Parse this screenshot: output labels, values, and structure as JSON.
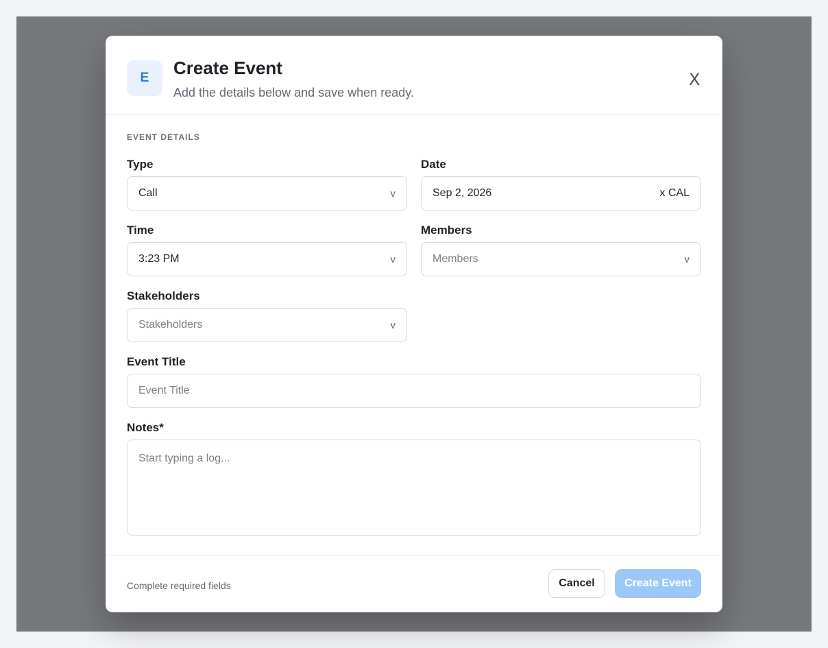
{
  "header": {
    "avatar_letter": "E",
    "title": "Create Event",
    "subtitle": "Add the details below and save when ready.",
    "close_label": "X"
  },
  "section": {
    "title": "EVENT DETAILS"
  },
  "fields": {
    "type": {
      "label": "Type",
      "value": "Call",
      "chevron": "v"
    },
    "date": {
      "label": "Date",
      "value": "Sep 2, 2026",
      "suffix": "x CAL"
    },
    "time": {
      "label": "Time",
      "value": "3:23 PM",
      "chevron": "v"
    },
    "members": {
      "label": "Members",
      "placeholder": "Members",
      "chevron": "v"
    },
    "stakeholders": {
      "label": "Stakeholders",
      "placeholder": "Stakeholders",
      "chevron": "v"
    },
    "event_title": {
      "label": "Event Title",
      "placeholder": "Event Title"
    },
    "notes": {
      "label": "Notes*",
      "placeholder": "Start typing a log..."
    }
  },
  "footer": {
    "note": "Complete required fields",
    "cancel_label": "Cancel",
    "create_label": "Create Event"
  },
  "colors": {
    "backdrop": "#76787c",
    "accent": "#2b7bd8",
    "primary_disabled": "#9cc8f7"
  },
  "icons": {
    "avatar": "event-initial-icon",
    "close": "close-icon",
    "chevron": "chevron-down-icon",
    "calendar": "calendar-icon"
  }
}
